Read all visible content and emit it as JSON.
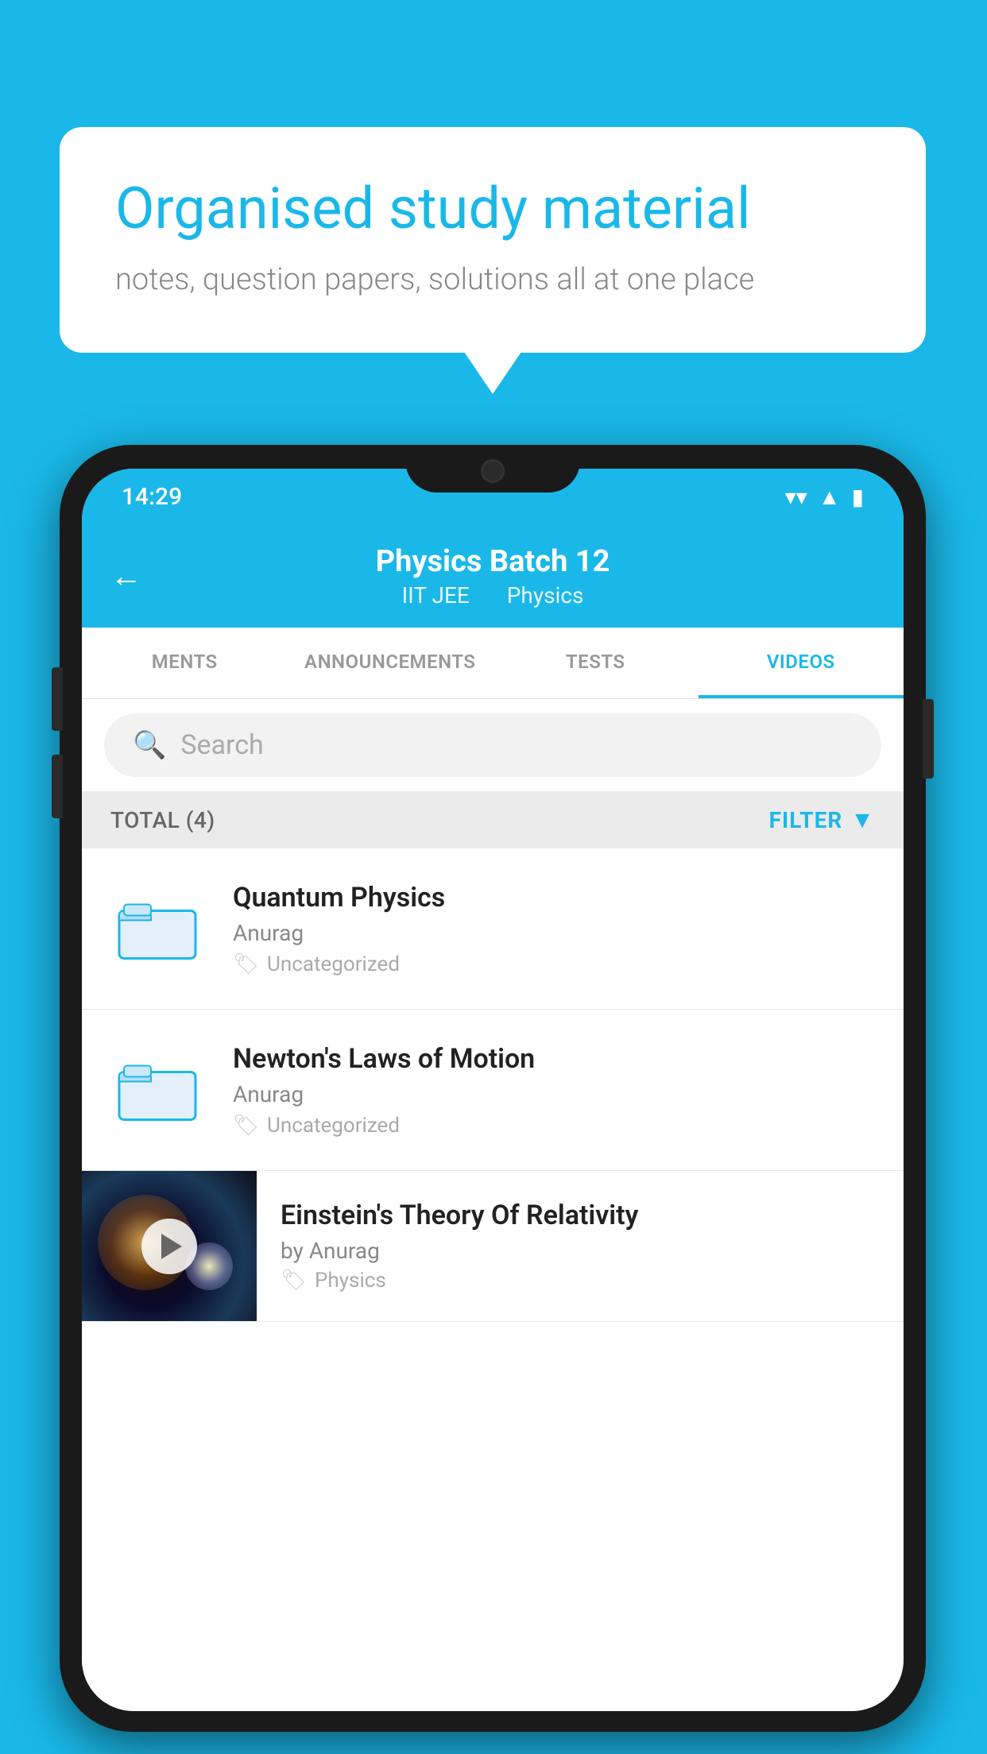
{
  "background": {
    "color": "#1ab8e8"
  },
  "speech_bubble": {
    "title": "Organised study material",
    "subtitle": "notes, question papers, solutions all at one place"
  },
  "phone": {
    "status_bar": {
      "time": "14:29"
    },
    "header": {
      "back_label": "←",
      "title": "Physics Batch 12",
      "subtitle_part1": "IIT JEE",
      "subtitle_part2": "Physics"
    },
    "tabs": [
      {
        "label": "MENTS",
        "active": false
      },
      {
        "label": "ANNOUNCEMENTS",
        "active": false
      },
      {
        "label": "TESTS",
        "active": false
      },
      {
        "label": "VIDEOS",
        "active": true
      }
    ],
    "search": {
      "placeholder": "Search"
    },
    "filter_bar": {
      "total_label": "TOTAL (4)",
      "filter_label": "FILTER"
    },
    "videos": [
      {
        "id": 1,
        "type": "folder",
        "title": "Quantum Physics",
        "author": "Anurag",
        "tag": "Uncategorized"
      },
      {
        "id": 2,
        "type": "folder",
        "title": "Newton's Laws of Motion",
        "author": "Anurag",
        "tag": "Uncategorized"
      },
      {
        "id": 3,
        "type": "video",
        "title": "Einstein's Theory Of Relativity",
        "author": "by Anurag",
        "tag": "Physics"
      }
    ]
  }
}
